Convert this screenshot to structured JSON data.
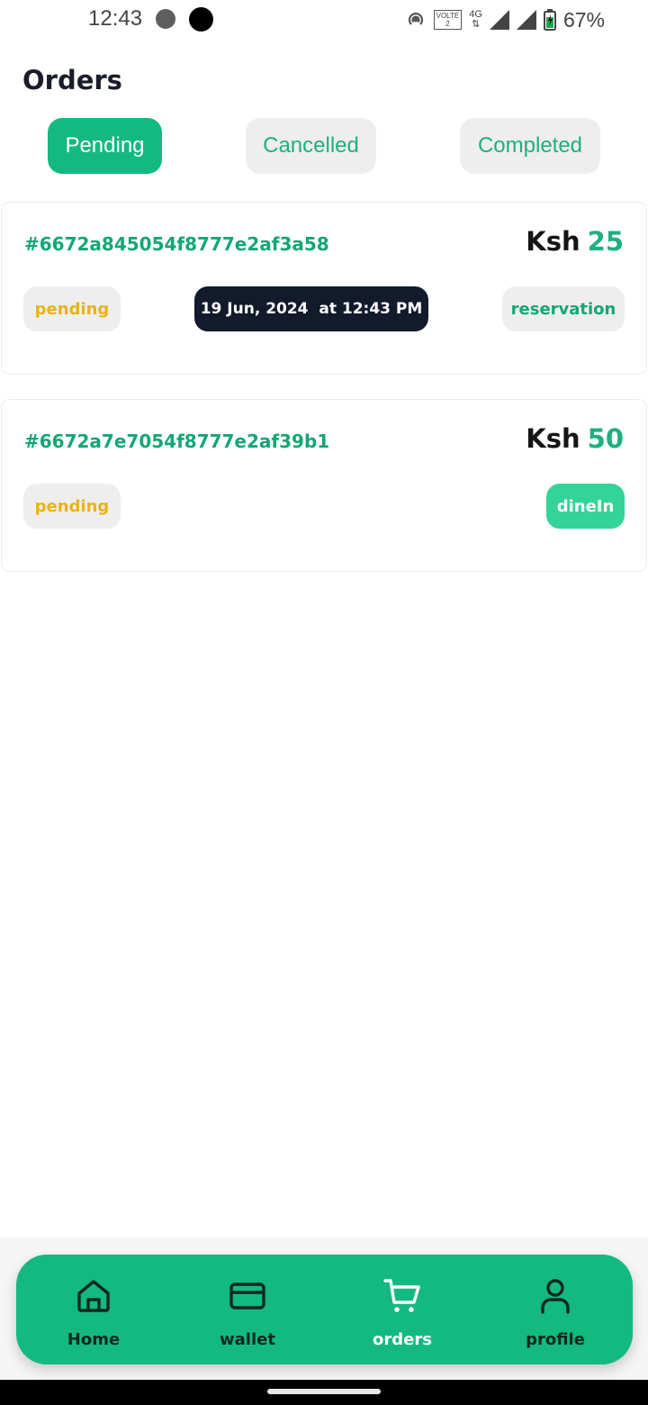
{
  "status_bar": {
    "time": "12:43",
    "battery": "67%",
    "network": "4G",
    "volte_label": "VOLTE",
    "volte_sim": "2"
  },
  "header": {
    "title": "Orders"
  },
  "tabs": [
    {
      "label": "Pending",
      "active": true
    },
    {
      "label": "Cancelled",
      "active": false
    },
    {
      "label": "Completed",
      "active": false
    }
  ],
  "orders": [
    {
      "id": "#6672a845054f8777e2af3a58",
      "currency": "Ksh",
      "amount": "25",
      "status": "pending",
      "date": "19 Jun, 2024  at 12:43 PM",
      "type": "reservation"
    },
    {
      "id": "#6672a7e7054f8777e2af39b1",
      "currency": "Ksh",
      "amount": "50",
      "status": "pending",
      "type": "dineIn"
    }
  ],
  "bottom_nav": [
    {
      "label": "Home",
      "icon": "home-icon",
      "active": false
    },
    {
      "label": "wallet",
      "icon": "card-icon",
      "active": false
    },
    {
      "label": "orders",
      "icon": "cart-icon",
      "active": true
    },
    {
      "label": "profile",
      "icon": "user-icon",
      "active": false
    }
  ],
  "colors": {
    "accent": "#13b981",
    "accent_text": "#13a676",
    "pending": "#e8b316",
    "dark_chip": "#121a2c",
    "dinein_chip": "#34d399"
  }
}
